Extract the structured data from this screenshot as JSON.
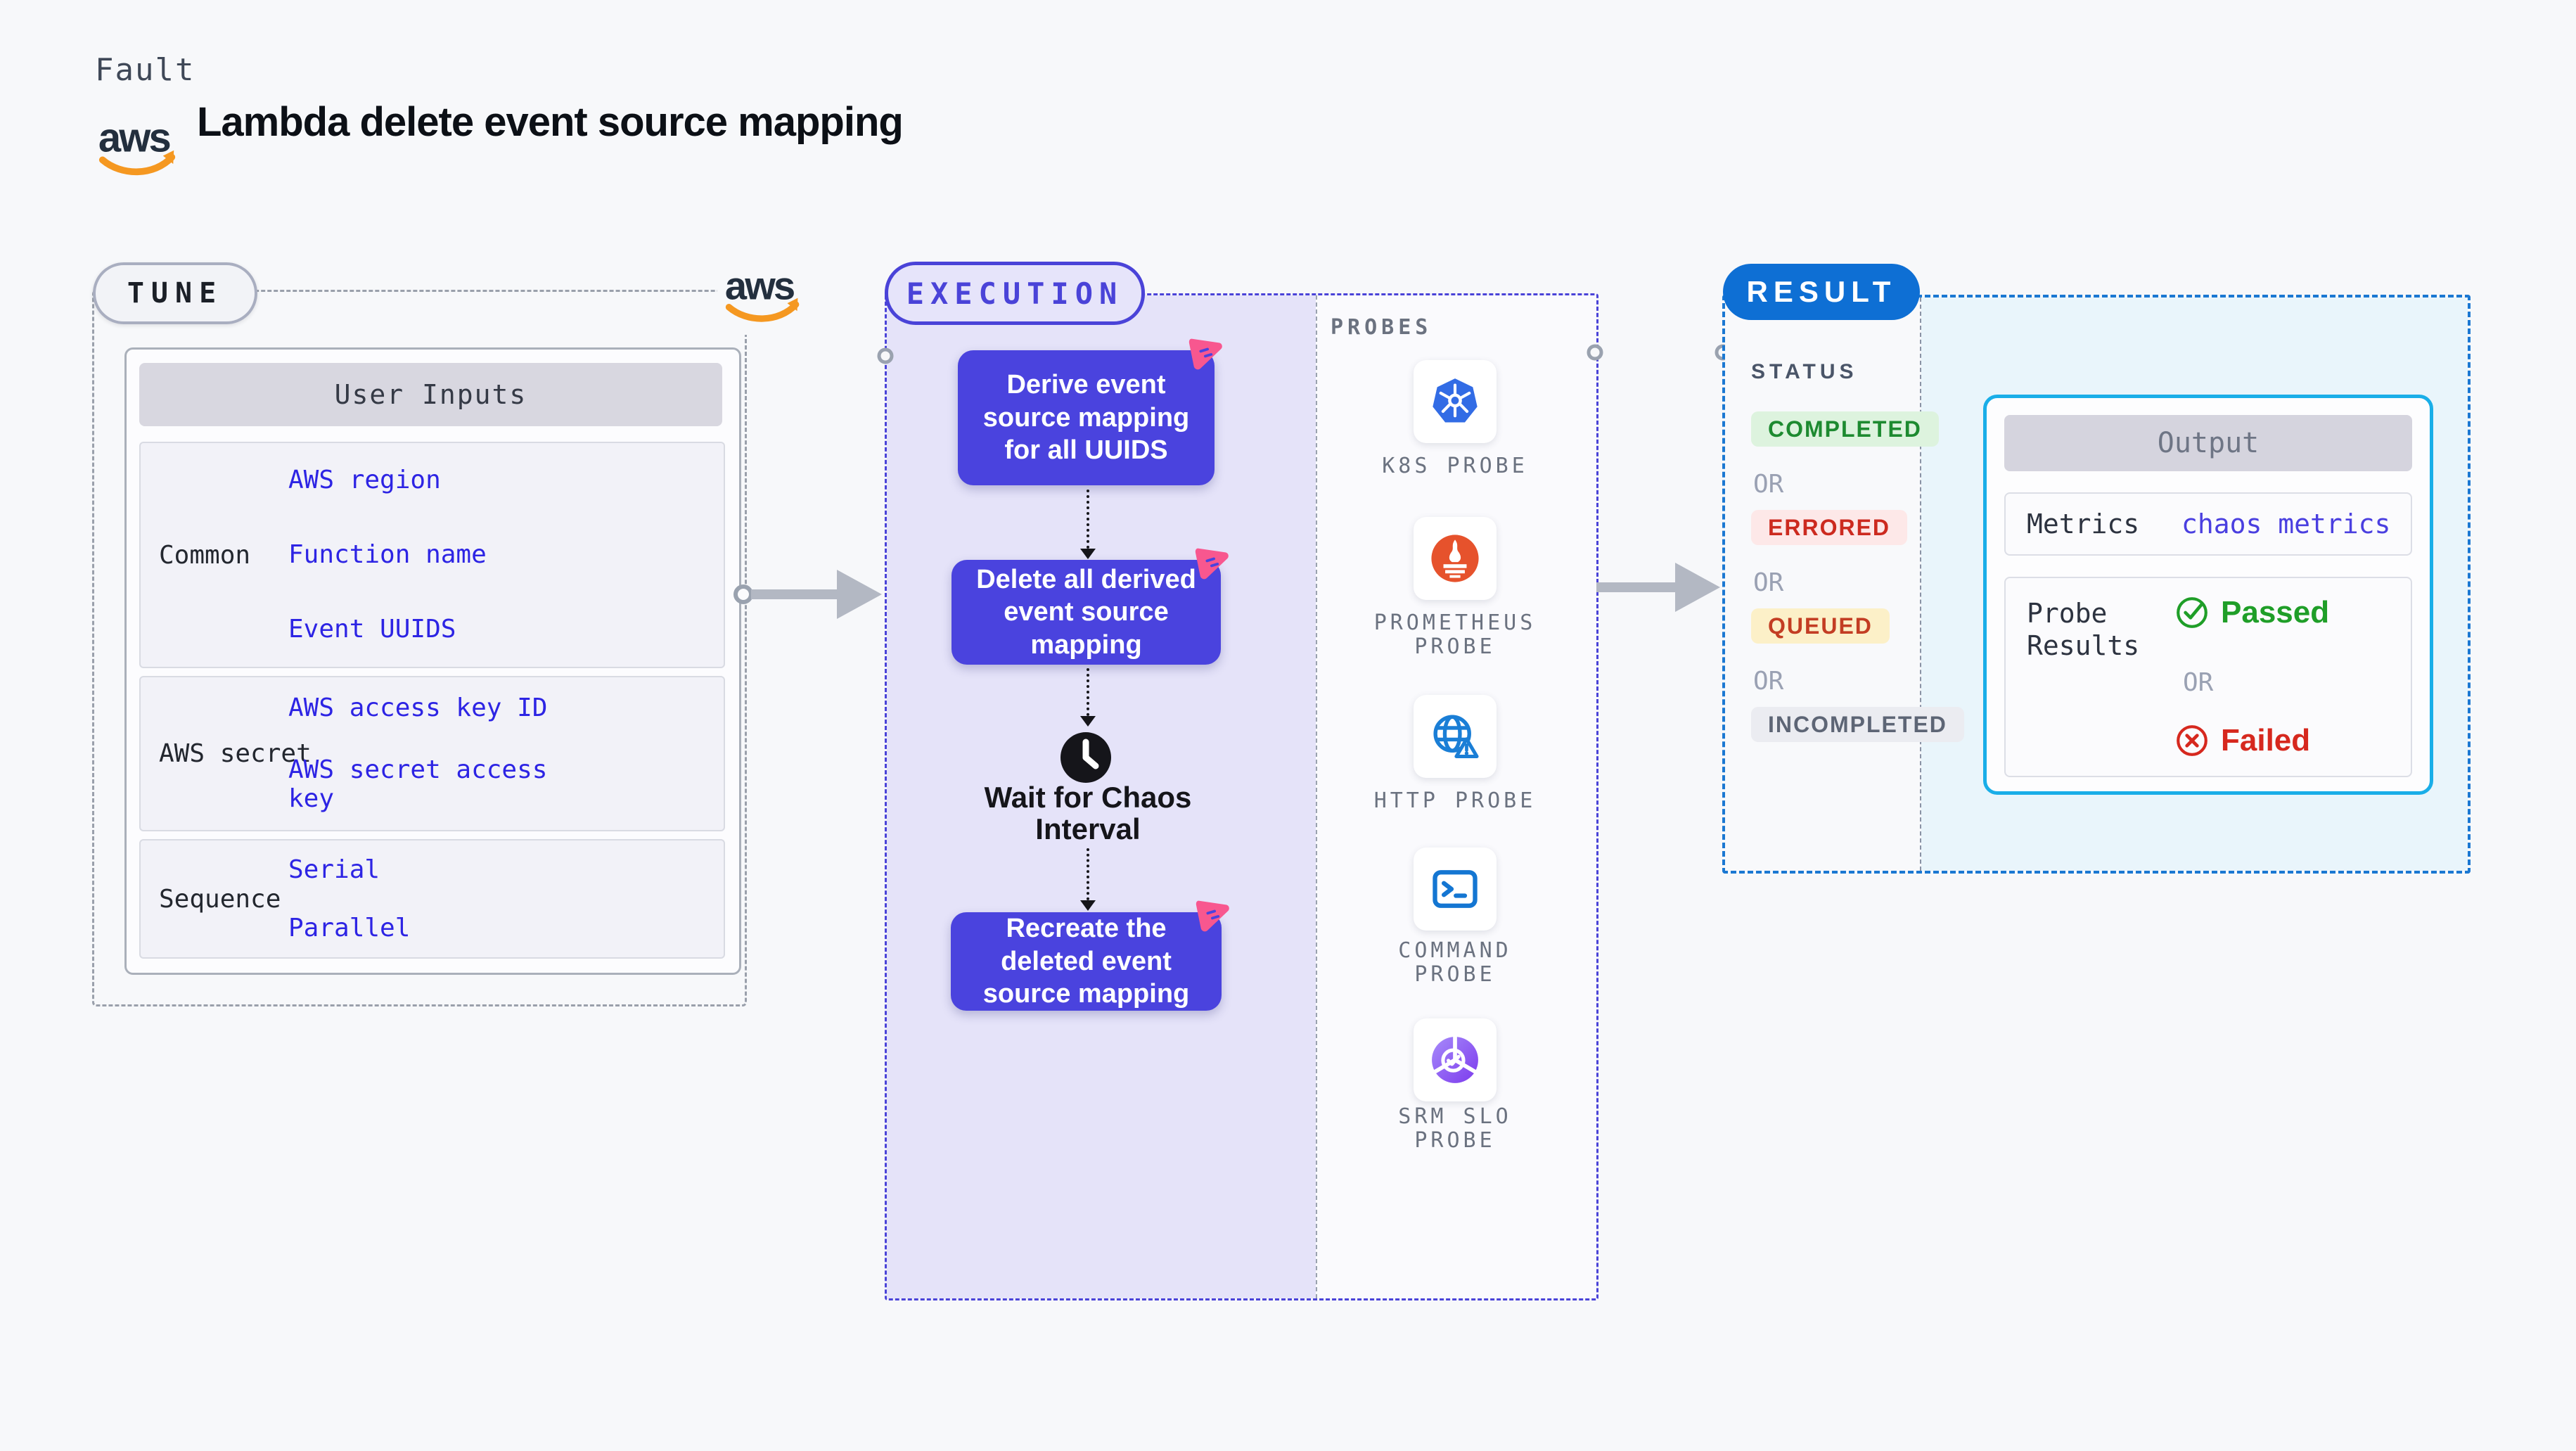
{
  "header": {
    "kicker": "Fault",
    "title": "Lambda delete event source mapping",
    "aws_wordmark": "aws"
  },
  "tune": {
    "badge": "TUNE",
    "table": {
      "header": "User Inputs",
      "rows": [
        {
          "label": "Common",
          "values": [
            "AWS region",
            "Function name",
            "Event UUIDS"
          ]
        },
        {
          "label": "AWS secret",
          "values": [
            "AWS access key ID",
            "AWS secret access key"
          ]
        },
        {
          "label": "Sequence",
          "values": [
            "Serial",
            "Parallel"
          ]
        }
      ]
    }
  },
  "execution": {
    "badge": "EXECUTION",
    "steps": [
      "Derive event source mapping for all UUIDS",
      "Delete all derived event source mapping",
      "Recreate the deleted event source mapping"
    ],
    "wait_label": "Wait for Chaos Interval",
    "probes": {
      "title": "PROBES",
      "items": [
        {
          "label": "K8S PROBE",
          "icon": "kubernetes-icon"
        },
        {
          "label": "PROMETHEUS PROBE",
          "icon": "prometheus-icon"
        },
        {
          "label": "HTTP PROBE",
          "icon": "http-globe-icon"
        },
        {
          "label": "COMMAND PROBE",
          "icon": "terminal-icon"
        },
        {
          "label": "SRM SLO PROBE",
          "icon": "srm-slo-icon"
        }
      ]
    }
  },
  "result": {
    "badge": "RESULT",
    "status": {
      "title": "STATUS",
      "or": "OR",
      "badges": [
        {
          "label": "COMPLETED"
        },
        {
          "label": "ERRORED"
        },
        {
          "label": "QUEUED"
        },
        {
          "label": "INCOMPLETED"
        }
      ]
    },
    "output": {
      "title": "Output",
      "metrics_label": "Metrics",
      "metrics_value": "chaos metrics",
      "probe_results_label": "Probe Results",
      "passed": "Passed",
      "or": "OR",
      "failed": "Failed"
    }
  },
  "colors": {
    "page_bg": "#f7f8fa",
    "step_indigo": "#4a43de",
    "execution_accent": "#4a43d8",
    "execution_fill": "#e5e3f9",
    "tune_dash": "#9aa0ab",
    "result_blue": "#0e6fd4",
    "result_dash": "#1b78d2",
    "output_border_cyan": "#19aee8",
    "output_zone_bg": "#e9f5fb",
    "link_blue": "#2d24e4",
    "completed_green": "#1d8a30",
    "errored_red": "#cc2a1f",
    "queued_amber_bg": "#fcf0c8",
    "passed_green": "#1f9e28",
    "failed_red": "#d6281e",
    "pin_pink": "#f8578f",
    "aws_orange": "#f59821",
    "k8s_blue": "#326ce5",
    "prometheus_orange": "#e6522c"
  }
}
